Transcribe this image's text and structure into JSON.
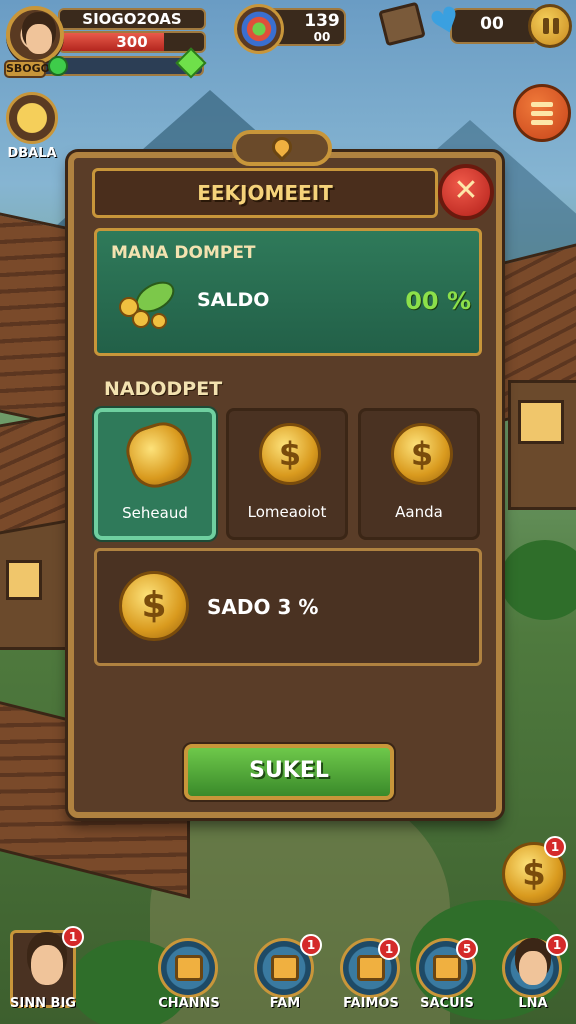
{
  "hud": {
    "player_name": "SIOGO2OAS",
    "hp_text": "300",
    "hp_fraction": 0.72,
    "level_tag": "SBOGO",
    "resource_top": "139",
    "resource_bottom": "00",
    "hearts": "00",
    "coin_button_label": "DBALA"
  },
  "panel": {
    "title": "EEKJOMEEIT",
    "close_glyph": "✕",
    "wallet": {
      "title": "MANA DOMPET",
      "saldo_label": "SALDO",
      "saldo_value": "00 %"
    },
    "section_label": "NADODPET",
    "options": [
      {
        "label": "Sehеаud",
        "icon": "coin-stack-icon",
        "selected": true
      },
      {
        "label": "Lomeaoiot",
        "icon": "dollar-coin-icon",
        "selected": false
      },
      {
        "label": "Aanda",
        "icon": "dollar-coin-icon",
        "selected": false
      }
    ],
    "balance_text": "SADO 3 %",
    "submit_label": "SUKEL"
  },
  "coin_symbol": "$",
  "side_coin_badge": "1",
  "dock": [
    {
      "label": "SINN BIG",
      "badge": "1"
    },
    {
      "label": "CHANNS",
      "badge": ""
    },
    {
      "label": "FAM",
      "badge": "1"
    },
    {
      "label": "FAIMOS",
      "badge": "1"
    },
    {
      "label": "SACUIS",
      "badge": "5"
    },
    {
      "label": "LNA",
      "badge": "1"
    }
  ],
  "colors": {
    "panel": "#5a3d28",
    "gold": "#c8963a",
    "wallet_green": "#2f7a5a",
    "button_green": "#3a8a2a",
    "close_red": "#b3201a"
  }
}
